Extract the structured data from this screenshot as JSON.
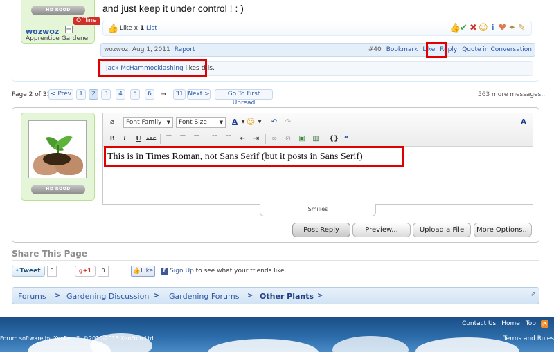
{
  "top_post": {
    "user_badge": "HD ROOD",
    "username": "wozwoz",
    "status": "Offline",
    "user_title": "Apprentice Gardener",
    "message": "and just keep it under control ! : )",
    "likes_prefix": "Like x",
    "likes_count": "1",
    "list_link": "List",
    "meta_author_date": "wozwoz, Aug 1, 2011",
    "report_link": "Report",
    "post_number": "#40",
    "bookmark_link": "Bookmark",
    "like_link": "Like",
    "reply_link": "Reply",
    "quote_link": "Quote in Conversation",
    "liked_by_user": "Jack McHammocklashing",
    "liked_by_suffix": "likes this.",
    "rating_icons": [
      "thumbs-up-icon",
      "check-icon",
      "x-icon",
      "smile-icon",
      "info-icon",
      "heart-icon",
      "wrench-icon",
      "pencil-icon"
    ]
  },
  "page_nav": {
    "label": "Page 2 of 31",
    "prev": "< Prev",
    "pages": [
      "1",
      "2",
      "3",
      "4",
      "5",
      "6"
    ],
    "current": "2",
    "arrow": "→",
    "last": "31",
    "next": "Next >",
    "first_unread": "Go To First Unread",
    "more_messages": "563 more messages..."
  },
  "reply": {
    "user_badge": "HD ROOD",
    "toolbar": {
      "font_family": "Font Family",
      "font_size": "Font Size"
    },
    "editor_text": "This is in Times Roman, not Sans Serif (but it posts in Sans Serif)",
    "smilies": "Smilies",
    "post_reply": "Post Reply",
    "preview": "Preview...",
    "upload": "Upload a File",
    "more_options": "More Options..."
  },
  "share": {
    "title": "Share This Page",
    "tweet": "Tweet",
    "tweet_count": "0",
    "gplus": "+1",
    "gplus_count": "0",
    "fb_like": "Like",
    "fb_signup_link": "Sign Up",
    "fb_signup_text": "to see what your friends like."
  },
  "breadcrumb": {
    "items": [
      "Forums",
      "Gardening Discussion",
      "Gardening Forums",
      "Other Plants"
    ],
    "sep": ">"
  },
  "footer": {
    "links": [
      "Contact Us",
      "Home",
      "Top"
    ],
    "copyright": "Forum software by XenForo™ ©2010-2013 XenForo Ltd.",
    "terms": "Terms and Rules"
  },
  "colors": {
    "link": "#2b57a8",
    "highlight": "#e00000",
    "user_block": "#e4f5d8"
  }
}
